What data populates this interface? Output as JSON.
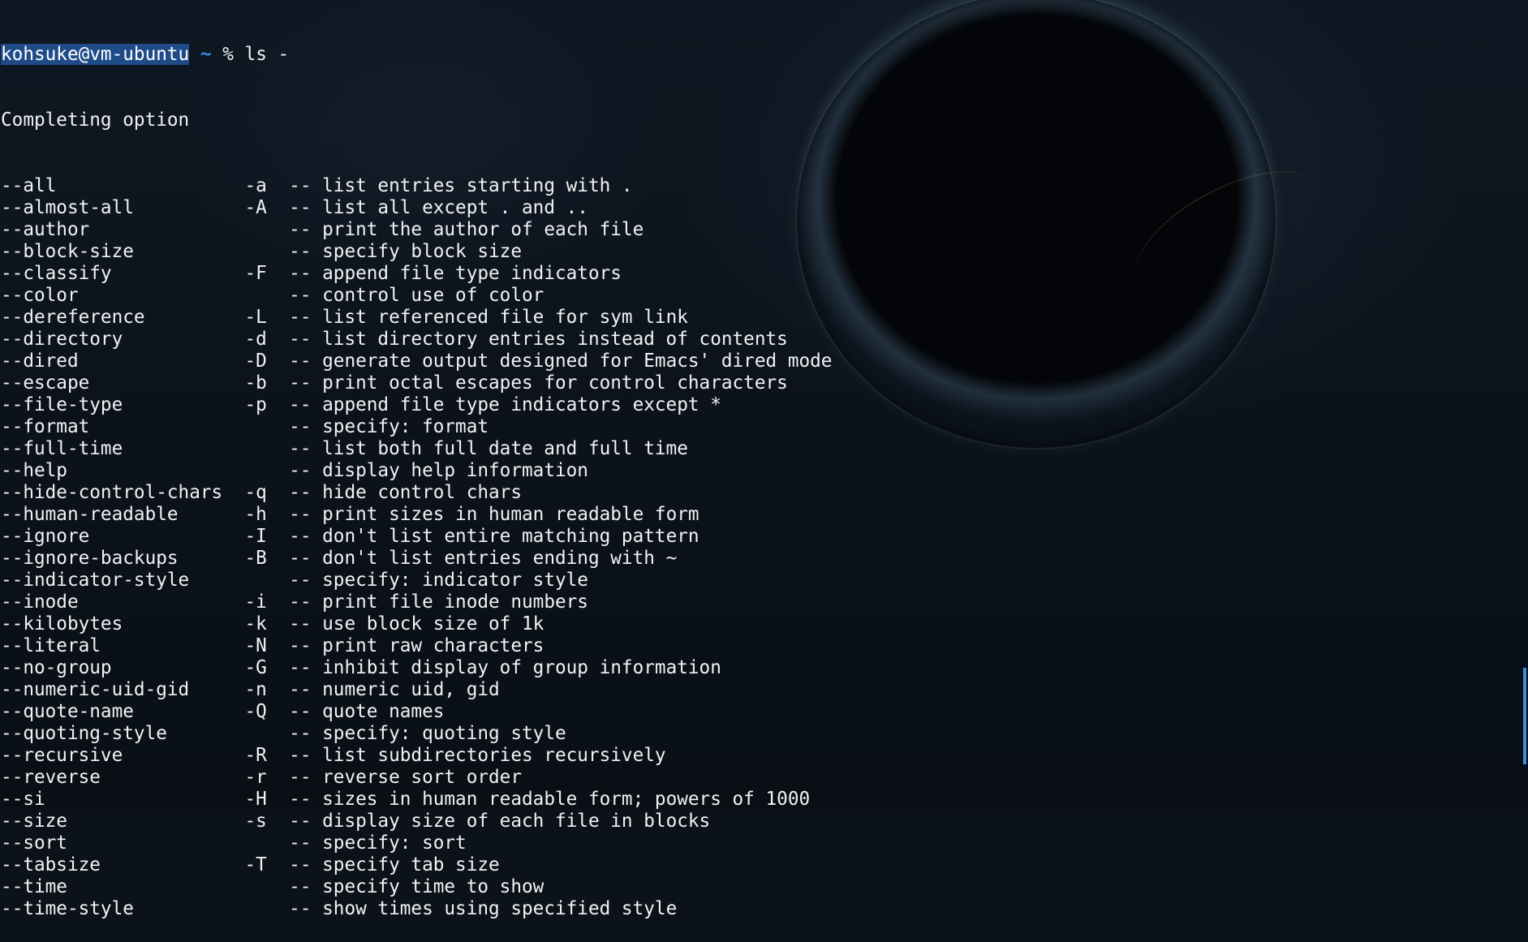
{
  "prompt": {
    "user_host": "kohsuke@vm-ubuntu",
    "path": "~",
    "symbol": "%",
    "command": "ls -"
  },
  "completion_header": "Completing option",
  "options": [
    {
      "long": "--all",
      "short": "-a",
      "desc": "list entries starting with ."
    },
    {
      "long": "--almost-all",
      "short": "-A",
      "desc": "list all except . and .."
    },
    {
      "long": "--author",
      "short": "",
      "desc": "print the author of each file"
    },
    {
      "long": "--block-size",
      "short": "",
      "desc": "specify block size"
    },
    {
      "long": "--classify",
      "short": "-F",
      "desc": "append file type indicators"
    },
    {
      "long": "--color",
      "short": "",
      "desc": "control use of color"
    },
    {
      "long": "--dereference",
      "short": "-L",
      "desc": "list referenced file for sym link"
    },
    {
      "long": "--directory",
      "short": "-d",
      "desc": "list directory entries instead of contents"
    },
    {
      "long": "--dired",
      "short": "-D",
      "desc": "generate output designed for Emacs' dired mode"
    },
    {
      "long": "--escape",
      "short": "-b",
      "desc": "print octal escapes for control characters"
    },
    {
      "long": "--file-type",
      "short": "-p",
      "desc": "append file type indicators except *"
    },
    {
      "long": "--format",
      "short": "",
      "desc": "specify: format"
    },
    {
      "long": "--full-time",
      "short": "",
      "desc": "list both full date and full time"
    },
    {
      "long": "--help",
      "short": "",
      "desc": "display help information"
    },
    {
      "long": "--hide-control-chars",
      "short": "-q",
      "desc": "hide control chars"
    },
    {
      "long": "--human-readable",
      "short": "-h",
      "desc": "print sizes in human readable form"
    },
    {
      "long": "--ignore",
      "short": "-I",
      "desc": "don't list entire matching pattern"
    },
    {
      "long": "--ignore-backups",
      "short": "-B",
      "desc": "don't list entries ending with ~"
    },
    {
      "long": "--indicator-style",
      "short": "",
      "desc": "specify: indicator style"
    },
    {
      "long": "--inode",
      "short": "-i",
      "desc": "print file inode numbers"
    },
    {
      "long": "--kilobytes",
      "short": "-k",
      "desc": "use block size of 1k"
    },
    {
      "long": "--literal",
      "short": "-N",
      "desc": "print raw characters"
    },
    {
      "long": "--no-group",
      "short": "-G",
      "desc": "inhibit display of group information"
    },
    {
      "long": "--numeric-uid-gid",
      "short": "-n",
      "desc": "numeric uid, gid"
    },
    {
      "long": "--quote-name",
      "short": "-Q",
      "desc": "quote names"
    },
    {
      "long": "--quoting-style",
      "short": "",
      "desc": "specify: quoting style"
    },
    {
      "long": "--recursive",
      "short": "-R",
      "desc": "list subdirectories recursively"
    },
    {
      "long": "--reverse",
      "short": "-r",
      "desc": "reverse sort order"
    },
    {
      "long": "--si",
      "short": "-H",
      "desc": "sizes in human readable form; powers of 1000"
    },
    {
      "long": "--size",
      "short": "-s",
      "desc": "display size of each file in blocks"
    },
    {
      "long": "--sort",
      "short": "",
      "desc": "specify: sort"
    },
    {
      "long": "--tabsize",
      "short": "-T",
      "desc": "specify tab size"
    },
    {
      "long": "--time",
      "short": "",
      "desc": "specify time to show"
    },
    {
      "long": "--time-style",
      "short": "",
      "desc": "show times using specified style"
    }
  ],
  "colors": {
    "background": "#0c1219",
    "text": "#f2f2f2",
    "selection": "#1f4c88",
    "prompt_path": "#3b8eea",
    "scrollbar": "#3c8fd7"
  }
}
